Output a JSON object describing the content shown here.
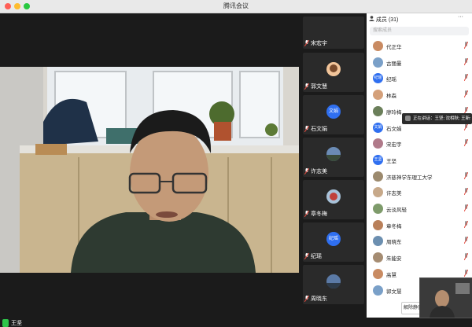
{
  "window": {
    "title": "腾讯会议"
  },
  "colors": {
    "accent": "#2f6ff0",
    "mute_red": "#e34a3f",
    "active_green": "#2ec64a"
  },
  "main_speaker": {
    "name": "王坚"
  },
  "thumbnails": [
    {
      "name": "宋宏宇",
      "type": "photo",
      "muted": true
    },
    {
      "name": "郭文慧",
      "type": "photo",
      "muted": true
    },
    {
      "name": "石文娟",
      "type": "avatar",
      "initials": "文娟",
      "muted": true
    },
    {
      "name": "许志美",
      "type": "photo",
      "muted": true
    },
    {
      "name": "章冬梅",
      "type": "photo",
      "muted": true
    },
    {
      "name": "纪瑶",
      "type": "avatar",
      "initials": "纪瑶",
      "muted": true
    },
    {
      "name": "周晓东",
      "type": "photo",
      "muted": true
    }
  ],
  "participants_panel": {
    "title": "成员 (31)",
    "more": "···",
    "search_placeholder": "搜索成员",
    "members": [
      {
        "name": "代正华",
        "avatar": "photo",
        "muted": true
      },
      {
        "name": "古丽曼",
        "avatar": "photo",
        "muted": true
      },
      {
        "name": "纪瑶",
        "avatar": "blue",
        "initials": "纪瑶",
        "muted": true
      },
      {
        "name": "林森",
        "avatar": "photo",
        "muted": true
      },
      {
        "name": "廖玲梅",
        "avatar": "photo",
        "muted": true
      },
      {
        "name": "石文娟",
        "avatar": "blue",
        "initials": "文娟",
        "muted": true
      },
      {
        "name": "宋宏宇",
        "avatar": "photo",
        "muted": true
      },
      {
        "name": "王坚",
        "avatar": "blue",
        "initials": "王坚",
        "muted": false
      },
      {
        "name": "济慈神学东理工大学",
        "avatar": "photo",
        "muted": true
      },
      {
        "name": "许志美",
        "avatar": "photo",
        "muted": true
      },
      {
        "name": "云淡风轻",
        "avatar": "photo",
        "muted": true
      },
      {
        "name": "章冬梅",
        "avatar": "photo",
        "muted": true
      },
      {
        "name": "周晓东",
        "avatar": "photo",
        "muted": true
      },
      {
        "name": "朱能安",
        "avatar": "photo",
        "muted": true
      },
      {
        "name": "高慧",
        "avatar": "photo",
        "muted": true
      },
      {
        "name": "郭文慧",
        "avatar": "photo",
        "muted": true
      }
    ],
    "unmute_all_label": "解除静音"
  },
  "tooltip": {
    "text": "正在讲话：王坚; 沈相秋; 王新:"
  }
}
